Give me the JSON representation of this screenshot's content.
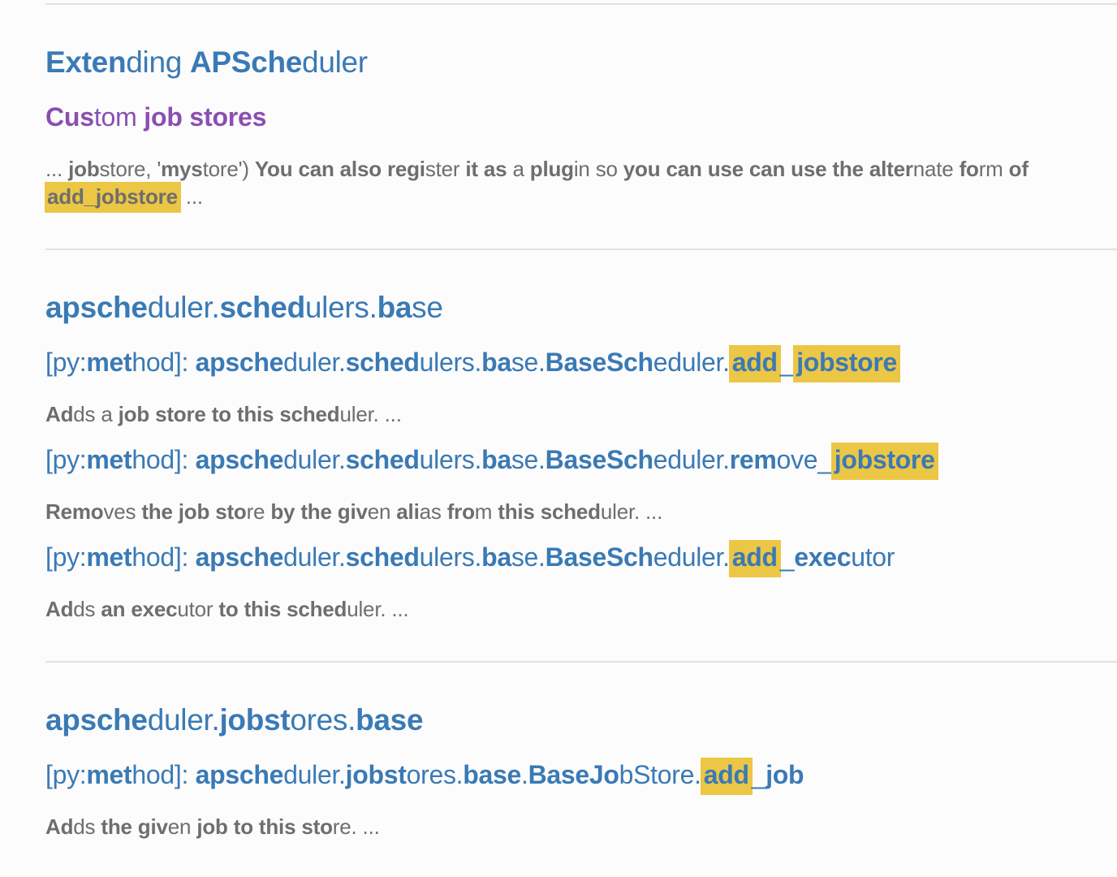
{
  "results": [
    {
      "title": [
        {
          "text": "Exten",
          "b": true
        },
        {
          "text": "ding "
        },
        {
          "text": "APSche",
          "b": true
        },
        {
          "text": "duler"
        }
      ],
      "entries": [
        {
          "kind": "sub",
          "text": [
            {
              "text": "Cus",
              "b": true
            },
            {
              "text": "tom "
            },
            {
              "text": "job",
              "b": true
            },
            {
              "text": " "
            },
            {
              "text": "stores",
              "b": true
            }
          ]
        },
        {
          "kind": "snippet",
          "text": [
            {
              "text": "... "
            },
            {
              "text": "job",
              "b": true
            },
            {
              "text": "store, '"
            },
            {
              "text": "mys",
              "b": true
            },
            {
              "text": "tore') "
            },
            {
              "text": "You",
              "b": true
            },
            {
              "text": " "
            },
            {
              "text": "can",
              "b": true
            },
            {
              "text": " "
            },
            {
              "text": "also",
              "b": true
            },
            {
              "text": " "
            },
            {
              "text": "regi",
              "b": true
            },
            {
              "text": "ster "
            },
            {
              "text": "it",
              "b": true
            },
            {
              "text": " "
            },
            {
              "text": "as",
              "b": true
            },
            {
              "text": " a "
            },
            {
              "text": "plug",
              "b": true
            },
            {
              "text": "in so "
            },
            {
              "text": "you",
              "b": true
            },
            {
              "text": " "
            },
            {
              "text": "can",
              "b": true
            },
            {
              "text": " "
            },
            {
              "text": "use",
              "b": true
            },
            {
              "text": " "
            },
            {
              "text": "can",
              "b": true
            },
            {
              "text": " "
            },
            {
              "text": "use",
              "b": true
            },
            {
              "text": " "
            },
            {
              "text": "the",
              "b": true
            },
            {
              "text": " "
            },
            {
              "text": "alter",
              "b": true
            },
            {
              "text": "nate "
            },
            {
              "text": "fo",
              "b": true
            },
            {
              "text": "rm "
            },
            {
              "text": "of",
              "b": true
            }
          ]
        },
        {
          "kind": "snippet",
          "text": [
            {
              "text": "add_jobstore",
              "b": true,
              "hl": true
            },
            {
              "text": " ..."
            }
          ]
        }
      ]
    },
    {
      "title": [
        {
          "text": "apsche",
          "b": true
        },
        {
          "text": "duler."
        },
        {
          "text": "sched",
          "b": true
        },
        {
          "text": "ulers."
        },
        {
          "text": "ba",
          "b": true
        },
        {
          "text": "se"
        }
      ],
      "entries": [
        {
          "kind": "method",
          "text": [
            {
              "text": "[py:"
            },
            {
              "text": "met",
              "b": true
            },
            {
              "text": "hod]: "
            },
            {
              "text": "apsche",
              "b": true
            },
            {
              "text": "duler."
            },
            {
              "text": "sched",
              "b": true
            },
            {
              "text": "ulers."
            },
            {
              "text": "ba",
              "b": true
            },
            {
              "text": "se."
            },
            {
              "text": "BaseSch",
              "b": true
            },
            {
              "text": "eduler."
            },
            {
              "text": "add",
              "b": true,
              "hl": true
            },
            {
              "text": "_"
            },
            {
              "text": "jobstore",
              "b": true,
              "hl": true
            }
          ]
        },
        {
          "kind": "snippet",
          "text": [
            {
              "text": "Ad",
              "b": true
            },
            {
              "text": "ds a "
            },
            {
              "text": "job",
              "b": true
            },
            {
              "text": " "
            },
            {
              "text": "store",
              "b": true
            },
            {
              "text": " "
            },
            {
              "text": "to",
              "b": true
            },
            {
              "text": " "
            },
            {
              "text": "this",
              "b": true
            },
            {
              "text": " "
            },
            {
              "text": "sched",
              "b": true
            },
            {
              "text": "uler. ..."
            }
          ]
        },
        {
          "kind": "method",
          "text": [
            {
              "text": "[py:"
            },
            {
              "text": "met",
              "b": true
            },
            {
              "text": "hod]: "
            },
            {
              "text": "apsche",
              "b": true
            },
            {
              "text": "duler."
            },
            {
              "text": "sched",
              "b": true
            },
            {
              "text": "ulers."
            },
            {
              "text": "ba",
              "b": true
            },
            {
              "text": "se."
            },
            {
              "text": "BaseSch",
              "b": true
            },
            {
              "text": "eduler."
            },
            {
              "text": "rem",
              "b": true
            },
            {
              "text": "ove_"
            },
            {
              "text": "jobstore",
              "b": true,
              "hl": true
            }
          ]
        },
        {
          "kind": "snippet",
          "text": [
            {
              "text": "Remo",
              "b": true
            },
            {
              "text": "ves "
            },
            {
              "text": "the",
              "b": true
            },
            {
              "text": " "
            },
            {
              "text": "job",
              "b": true
            },
            {
              "text": " "
            },
            {
              "text": "sto",
              "b": true
            },
            {
              "text": "re "
            },
            {
              "text": "by",
              "b": true
            },
            {
              "text": " "
            },
            {
              "text": "the",
              "b": true
            },
            {
              "text": " "
            },
            {
              "text": "giv",
              "b": true
            },
            {
              "text": "en "
            },
            {
              "text": "ali",
              "b": true
            },
            {
              "text": "as "
            },
            {
              "text": "fro",
              "b": true
            },
            {
              "text": "m "
            },
            {
              "text": "this",
              "b": true
            },
            {
              "text": " "
            },
            {
              "text": "sched",
              "b": true
            },
            {
              "text": "uler. ..."
            }
          ]
        },
        {
          "kind": "method",
          "text": [
            {
              "text": "[py:"
            },
            {
              "text": "met",
              "b": true
            },
            {
              "text": "hod]: "
            },
            {
              "text": "apsche",
              "b": true
            },
            {
              "text": "duler."
            },
            {
              "text": "sched",
              "b": true
            },
            {
              "text": "ulers."
            },
            {
              "text": "ba",
              "b": true
            },
            {
              "text": "se."
            },
            {
              "text": "BaseSch",
              "b": true
            },
            {
              "text": "eduler."
            },
            {
              "text": "add",
              "b": true,
              "hl": true
            },
            {
              "text": "_"
            },
            {
              "text": "exec",
              "b": true
            },
            {
              "text": "utor"
            }
          ]
        },
        {
          "kind": "snippet",
          "text": [
            {
              "text": "Ad",
              "b": true
            },
            {
              "text": "ds "
            },
            {
              "text": "an",
              "b": true
            },
            {
              "text": " "
            },
            {
              "text": "exec",
              "b": true
            },
            {
              "text": "utor "
            },
            {
              "text": "to",
              "b": true
            },
            {
              "text": " "
            },
            {
              "text": "this",
              "b": true
            },
            {
              "text": " "
            },
            {
              "text": "sched",
              "b": true
            },
            {
              "text": "uler. ..."
            }
          ]
        }
      ]
    },
    {
      "title": [
        {
          "text": "apsche",
          "b": true
        },
        {
          "text": "duler."
        },
        {
          "text": "jobst",
          "b": true
        },
        {
          "text": "ores."
        },
        {
          "text": "base",
          "b": true
        }
      ],
      "entries": [
        {
          "kind": "method",
          "text": [
            {
              "text": "[py:"
            },
            {
              "text": "met",
              "b": true
            },
            {
              "text": "hod]: "
            },
            {
              "text": "apsche",
              "b": true
            },
            {
              "text": "duler."
            },
            {
              "text": "jobst",
              "b": true
            },
            {
              "text": "ores."
            },
            {
              "text": "base",
              "b": true
            },
            {
              "text": "."
            },
            {
              "text": "BaseJo",
              "b": true
            },
            {
              "text": "bStore."
            },
            {
              "text": "add",
              "b": true,
              "hl": true
            },
            {
              "text": "_"
            },
            {
              "text": "job",
              "b": true
            }
          ]
        },
        {
          "kind": "snippet",
          "text": [
            {
              "text": "Ad",
              "b": true
            },
            {
              "text": "ds "
            },
            {
              "text": "the",
              "b": true
            },
            {
              "text": " "
            },
            {
              "text": "giv",
              "b": true
            },
            {
              "text": "en "
            },
            {
              "text": "job",
              "b": true
            },
            {
              "text": " "
            },
            {
              "text": "to",
              "b": true
            },
            {
              "text": " "
            },
            {
              "text": "this",
              "b": true
            },
            {
              "text": " "
            },
            {
              "text": "sto",
              "b": true
            },
            {
              "text": "re. ..."
            }
          ]
        }
      ]
    }
  ]
}
